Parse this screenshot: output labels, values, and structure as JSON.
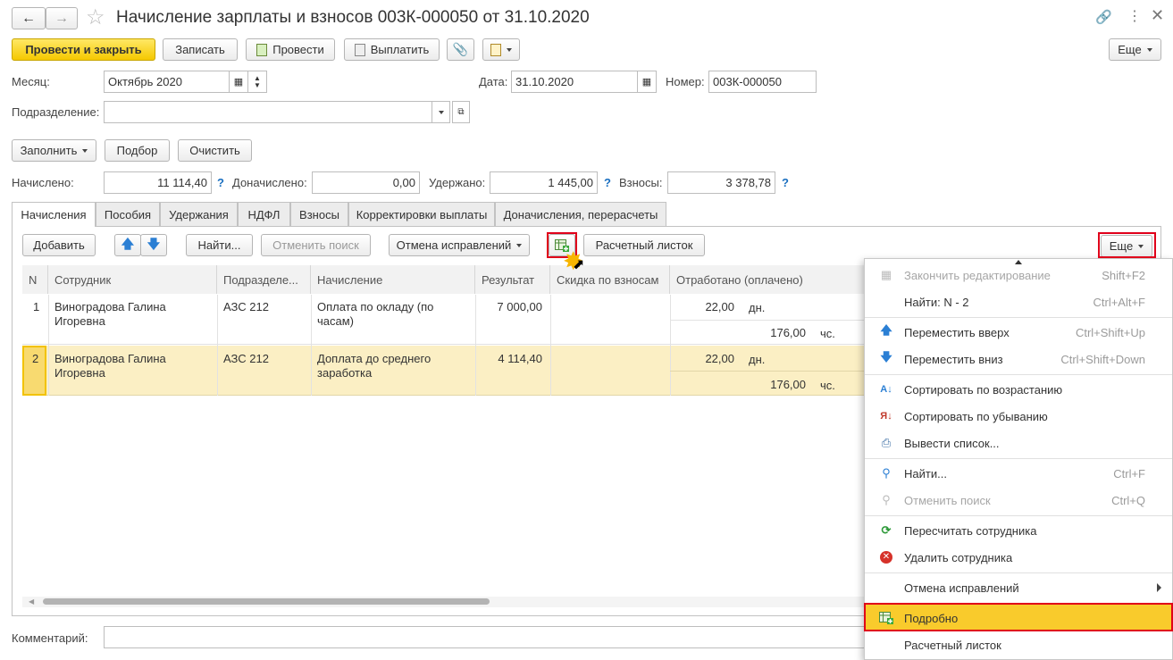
{
  "window": {
    "title": "Начисление зарплаты и взносов 003К-000050 от 31.10.2020"
  },
  "toolbar": {
    "post_close": "Провести и закрыть",
    "save": "Записать",
    "post": "Провести",
    "pay": "Выплатить",
    "more": "Еще"
  },
  "fields": {
    "month_label": "Месяц:",
    "month_value": "Октябрь 2020",
    "date_label": "Дата:",
    "date_value": "31.10.2020",
    "number_label": "Номер:",
    "number_value": "003К-000050",
    "division_label": "Подразделение:",
    "division_value": ""
  },
  "actions": {
    "fill": "Заполнить",
    "select": "Подбор",
    "clear": "Очистить"
  },
  "totals": {
    "accrued_label": "Начислено:",
    "accrued": "11 114,40",
    "additional_label": "Доначислено:",
    "additional": "0,00",
    "withheld_label": "Удержано:",
    "withheld": "1 445,00",
    "contrib_label": "Взносы:",
    "contrib": "3 378,78",
    "help": "?"
  },
  "tabs": [
    "Начисления",
    "Пособия",
    "Удержания",
    "НДФЛ",
    "Взносы",
    "Корректировки выплаты",
    "Доначисления, перерасчеты"
  ],
  "table_toolbar": {
    "add": "Добавить",
    "find": "Найти...",
    "cancel_search": "Отменить поиск",
    "cancel_corrections": "Отмена исправлений",
    "payslip": "Расчетный листок",
    "more": "Еще"
  },
  "table": {
    "headers": [
      "N",
      "Сотрудник",
      "Подразделе...",
      "Начисление",
      "Результат",
      "Скидка по взносам",
      "Отработано (оплачено)"
    ],
    "rows": [
      {
        "n": "1",
        "employee": "Виноградова Галина Игоревна",
        "division": "АЗС 212",
        "accrual": "Оплата по окладу (по часам)",
        "result": "7 000,00",
        "discount": "",
        "days": "22,00",
        "days_unit": "дн.",
        "hours": "176,00",
        "hours_unit": "чс."
      },
      {
        "n": "2",
        "employee": "Виноградова Галина Игоревна",
        "division": "АЗС 212",
        "accrual": "Доплата до среднего заработка",
        "result": "4 114,40",
        "discount": "",
        "days": "22,00",
        "days_unit": "дн.",
        "hours": "176,00",
        "hours_unit": "чс."
      }
    ]
  },
  "comment_label": "Комментарий:",
  "menu": {
    "items": [
      {
        "label": "Закончить редактирование",
        "shortcut": "Shift+F2"
      },
      {
        "label": "Найти: N - 2",
        "shortcut": "Ctrl+Alt+F"
      },
      {
        "label": "Переместить вверх",
        "shortcut": "Ctrl+Shift+Up"
      },
      {
        "label": "Переместить вниз",
        "shortcut": "Ctrl+Shift+Down"
      },
      {
        "label": "Сортировать по возрастанию",
        "shortcut": ""
      },
      {
        "label": "Сортировать по убыванию",
        "shortcut": ""
      },
      {
        "label": "Вывести список...",
        "shortcut": ""
      },
      {
        "label": "Найти...",
        "shortcut": "Ctrl+F"
      },
      {
        "label": "Отменить поиск",
        "shortcut": "Ctrl+Q"
      },
      {
        "label": "Пересчитать сотрудника",
        "shortcut": ""
      },
      {
        "label": "Удалить сотрудника",
        "shortcut": ""
      },
      {
        "label": "Отмена исправлений",
        "shortcut": ""
      },
      {
        "label": "Подробно",
        "shortcut": ""
      },
      {
        "label": "Расчетный листок",
        "shortcut": ""
      }
    ]
  },
  "colors": {
    "accent_yellow": "#f5c800",
    "highlight_red": "#e0001a",
    "selected_row": "#fbefc4",
    "link_blue": "#1a6fc0"
  }
}
